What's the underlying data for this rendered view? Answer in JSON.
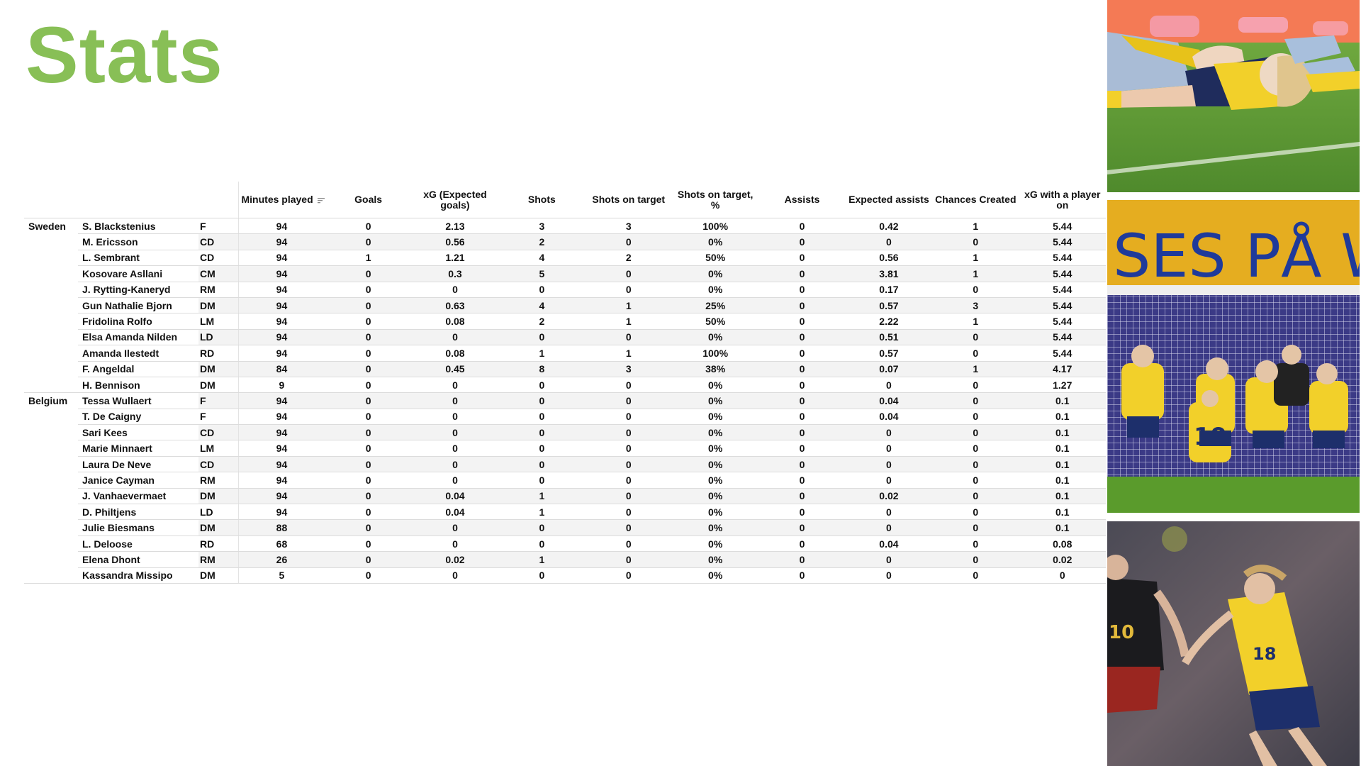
{
  "page": {
    "title": "Stats",
    "title_color": "#88bf56"
  },
  "table": {
    "columns": [
      {
        "key": "minutes",
        "label": "Minutes played",
        "sorted": true,
        "sort_icon": "sort-descending-icon"
      },
      {
        "key": "goals",
        "label": "Goals"
      },
      {
        "key": "xg",
        "label": "xG (Expected goals)"
      },
      {
        "key": "shots",
        "label": "Shots"
      },
      {
        "key": "sot",
        "label": "Shots on target"
      },
      {
        "key": "sot_pct",
        "label": "Shots on target, %"
      },
      {
        "key": "assists",
        "label": "Assists"
      },
      {
        "key": "xa",
        "label": "Expected assists"
      },
      {
        "key": "chances",
        "label": "Chances Created"
      },
      {
        "key": "xg_on",
        "label": "xG with a player on"
      }
    ],
    "groups": [
      {
        "team": "Sweden",
        "rows": [
          {
            "name": "S. Blackstenius",
            "pos": "F",
            "minutes": "94",
            "goals": "0",
            "xg": "2.13",
            "shots": "3",
            "sot": "3",
            "sot_pct": "100%",
            "assists": "0",
            "xa": "0.42",
            "chances": "1",
            "xg_on": "5.44"
          },
          {
            "name": "M. Ericsson",
            "pos": "CD",
            "minutes": "94",
            "goals": "0",
            "xg": "0.56",
            "shots": "2",
            "sot": "0",
            "sot_pct": "0%",
            "assists": "0",
            "xa": "0",
            "chances": "0",
            "xg_on": "5.44"
          },
          {
            "name": "L. Sembrant",
            "pos": "CD",
            "minutes": "94",
            "goals": "1",
            "xg": "1.21",
            "shots": "4",
            "sot": "2",
            "sot_pct": "50%",
            "assists": "0",
            "xa": "0.56",
            "chances": "1",
            "xg_on": "5.44"
          },
          {
            "name": "Kosovare Asllani",
            "pos": "CM",
            "minutes": "94",
            "goals": "0",
            "xg": "0.3",
            "shots": "5",
            "sot": "0",
            "sot_pct": "0%",
            "assists": "0",
            "xa": "3.81",
            "chances": "1",
            "xg_on": "5.44"
          },
          {
            "name": "J. Rytting-Kaneryd",
            "pos": "RM",
            "minutes": "94",
            "goals": "0",
            "xg": "0",
            "shots": "0",
            "sot": "0",
            "sot_pct": "0%",
            "assists": "0",
            "xa": "0.17",
            "chances": "0",
            "xg_on": "5.44"
          },
          {
            "name": "Gun Nathalie Bjorn",
            "pos": "DM",
            "minutes": "94",
            "goals": "0",
            "xg": "0.63",
            "shots": "4",
            "sot": "1",
            "sot_pct": "25%",
            "assists": "0",
            "xa": "0.57",
            "chances": "3",
            "xg_on": "5.44"
          },
          {
            "name": "Fridolina Rolfo",
            "pos": "LM",
            "minutes": "94",
            "goals": "0",
            "xg": "0.08",
            "shots": "2",
            "sot": "1",
            "sot_pct": "50%",
            "assists": "0",
            "xa": "2.22",
            "chances": "1",
            "xg_on": "5.44"
          },
          {
            "name": "Elsa Amanda Nilden",
            "pos": "LD",
            "minutes": "94",
            "goals": "0",
            "xg": "0",
            "shots": "0",
            "sot": "0",
            "sot_pct": "0%",
            "assists": "0",
            "xa": "0.51",
            "chances": "0",
            "xg_on": "5.44"
          },
          {
            "name": "Amanda Ilestedt",
            "pos": "RD",
            "minutes": "94",
            "goals": "0",
            "xg": "0.08",
            "shots": "1",
            "sot": "1",
            "sot_pct": "100%",
            "assists": "0",
            "xa": "0.57",
            "chances": "0",
            "xg_on": "5.44"
          },
          {
            "name": "F. Angeldal",
            "pos": "DM",
            "minutes": "84",
            "goals": "0",
            "xg": "0.45",
            "shots": "8",
            "sot": "3",
            "sot_pct": "38%",
            "assists": "0",
            "xa": "0.07",
            "chances": "1",
            "xg_on": "4.17"
          },
          {
            "name": "H. Bennison",
            "pos": "DM",
            "minutes": "9",
            "goals": "0",
            "xg": "0",
            "shots": "0",
            "sot": "0",
            "sot_pct": "0%",
            "assists": "0",
            "xa": "0",
            "chances": "0",
            "xg_on": "1.27"
          }
        ]
      },
      {
        "team": "Belgium",
        "rows": [
          {
            "name": "Tessa Wullaert",
            "pos": "F",
            "minutes": "94",
            "goals": "0",
            "xg": "0",
            "shots": "0",
            "sot": "0",
            "sot_pct": "0%",
            "assists": "0",
            "xa": "0.04",
            "chances": "0",
            "xg_on": "0.1"
          },
          {
            "name": "T. De Caigny",
            "pos": "F",
            "minutes": "94",
            "goals": "0",
            "xg": "0",
            "shots": "0",
            "sot": "0",
            "sot_pct": "0%",
            "assists": "0",
            "xa": "0.04",
            "chances": "0",
            "xg_on": "0.1"
          },
          {
            "name": "Sari Kees",
            "pos": "CD",
            "minutes": "94",
            "goals": "0",
            "xg": "0",
            "shots": "0",
            "sot": "0",
            "sot_pct": "0%",
            "assists": "0",
            "xa": "0",
            "chances": "0",
            "xg_on": "0.1"
          },
          {
            "name": "Marie Minnaert",
            "pos": "LM",
            "minutes": "94",
            "goals": "0",
            "xg": "0",
            "shots": "0",
            "sot": "0",
            "sot_pct": "0%",
            "assists": "0",
            "xa": "0",
            "chances": "0",
            "xg_on": "0.1"
          },
          {
            "name": "Laura De Neve",
            "pos": "CD",
            "minutes": "94",
            "goals": "0",
            "xg": "0",
            "shots": "0",
            "sot": "0",
            "sot_pct": "0%",
            "assists": "0",
            "xa": "0",
            "chances": "0",
            "xg_on": "0.1"
          },
          {
            "name": "Janice Cayman",
            "pos": "RM",
            "minutes": "94",
            "goals": "0",
            "xg": "0",
            "shots": "0",
            "sot": "0",
            "sot_pct": "0%",
            "assists": "0",
            "xa": "0",
            "chances": "0",
            "xg_on": "0.1"
          },
          {
            "name": "J. Vanhaevermaet",
            "pos": "DM",
            "minutes": "94",
            "goals": "0",
            "xg": "0.04",
            "shots": "1",
            "sot": "0",
            "sot_pct": "0%",
            "assists": "0",
            "xa": "0.02",
            "chances": "0",
            "xg_on": "0.1"
          },
          {
            "name": "D. Philtjens",
            "pos": "LD",
            "minutes": "94",
            "goals": "0",
            "xg": "0.04",
            "shots": "1",
            "sot": "0",
            "sot_pct": "0%",
            "assists": "0",
            "xa": "0",
            "chances": "0",
            "xg_on": "0.1"
          },
          {
            "name": "Julie Biesmans",
            "pos": "DM",
            "minutes": "88",
            "goals": "0",
            "xg": "0",
            "shots": "0",
            "sot": "0",
            "sot_pct": "0%",
            "assists": "0",
            "xa": "0",
            "chances": "0",
            "xg_on": "0.1"
          },
          {
            "name": "L. Deloose",
            "pos": "RD",
            "minutes": "68",
            "goals": "0",
            "xg": "0",
            "shots": "0",
            "sot": "0",
            "sot_pct": "0%",
            "assists": "0",
            "xa": "0.04",
            "chances": "0",
            "xg_on": "0.08"
          },
          {
            "name": "Elena Dhont",
            "pos": "RM",
            "minutes": "26",
            "goals": "0",
            "xg": "0.02",
            "shots": "1",
            "sot": "0",
            "sot_pct": "0%",
            "assists": "0",
            "xa": "0",
            "chances": "0",
            "xg_on": "0.02"
          },
          {
            "name": "Kassandra Missipo",
            "pos": "DM",
            "minutes": "5",
            "goals": "0",
            "xg": "0",
            "shots": "0",
            "sot": "0",
            "sot_pct": "0%",
            "assists": "0",
            "xa": "0",
            "chances": "0",
            "xg_on": "0"
          }
        ]
      }
    ]
  },
  "photos": [
    {
      "name": "photo-player-on-ground",
      "description": "Swedish player in yellow kit lying on the pitch"
    },
    {
      "name": "photo-team-celebration",
      "description": "Swedish players celebrating in front of goal under a yellow banner",
      "banner_text": "SES PÅ W"
    },
    {
      "name": "photo-player-dribbling",
      "description": "Swedish number 18 running past a Belgian player"
    }
  ],
  "colors": {
    "sweden_yellow": "#f2d02a",
    "sweden_blue": "#1d2f6b",
    "pitch_green": "#5e9b3a"
  }
}
